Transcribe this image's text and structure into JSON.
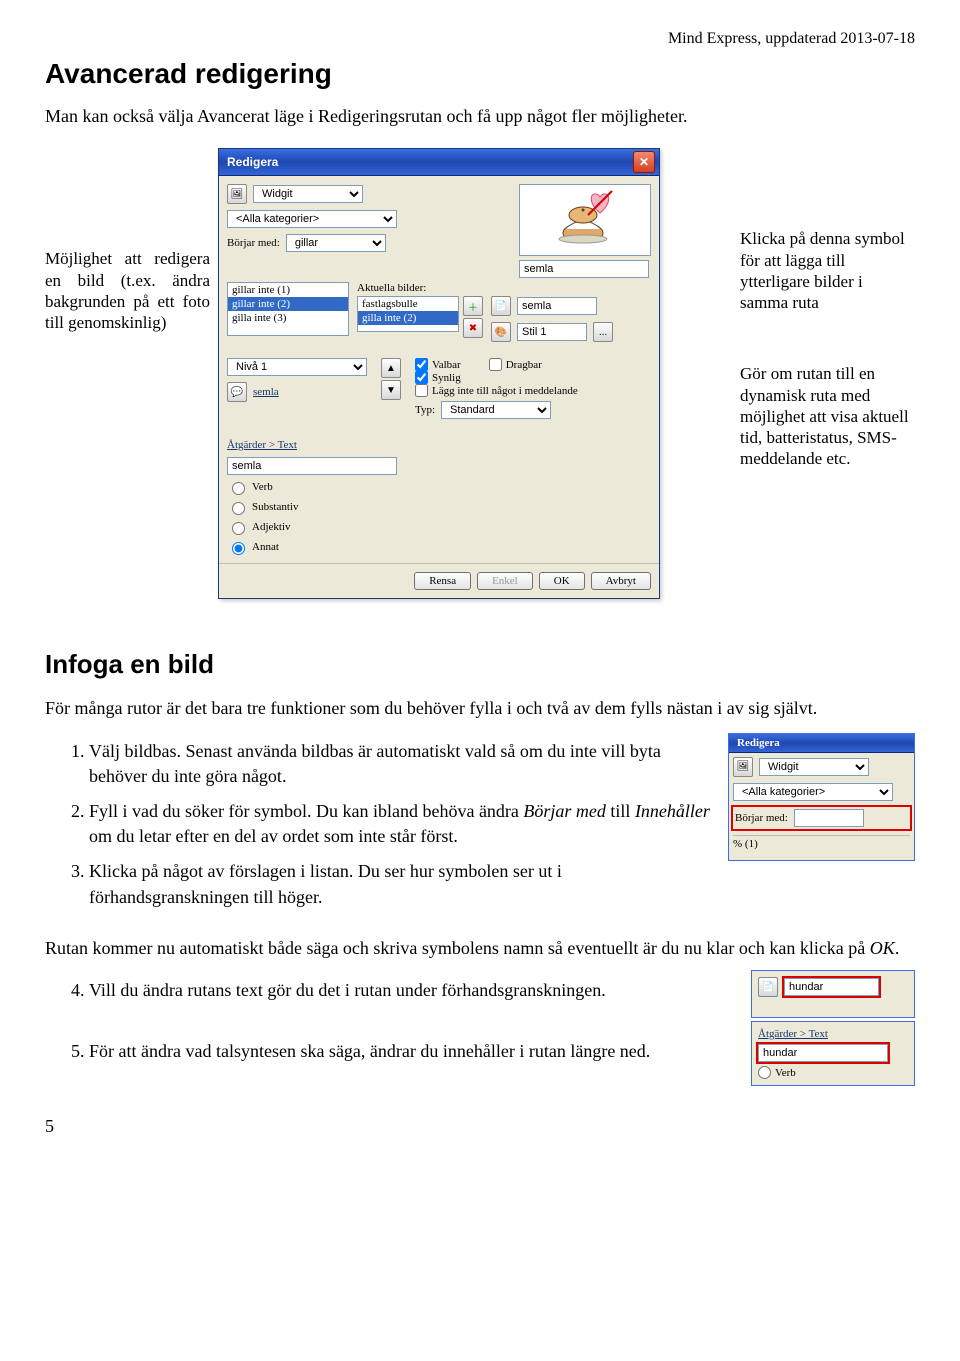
{
  "doc": {
    "header_right": "Mind Express, uppdaterad 2013-07-18",
    "page_number": "5",
    "h1": "Avancerad redigering",
    "intro": "Man kan också välja Avancerat läge i Redigeringsrutan och få upp något fler möjligheter.",
    "callout_left": "Möjlighet att redigera en bild (t.ex. ändra bakgrunden på ett foto till genomskinlig)",
    "callout_right_1": "Klicka på denna symbol för att lägga till ytterligare bilder i samma ruta",
    "callout_right_2": "Gör om rutan till en dynamisk ruta med möjlighet att visa aktuell tid, batteristatus, SMS-meddelande etc.",
    "h2": "Infoga en bild",
    "intro2": "För många rutor är det bara tre funktioner som du behöver fylla i och två av dem fylls nästan i av sig självt.",
    "steps": {
      "s1a": "Välj bildbas. Senast använda bildbas är automatiskt vald så om du inte vill byta behöver du inte göra något.",
      "s2a": "Fyll i vad du söker för symbol. Du kan ibland behöva ändra ",
      "s2_borjar": "Börjar med",
      "s2b": " till ",
      "s2_inne": "Innehåller",
      "s2c": " om du letar efter en del av ordet som inte står först.",
      "s3": "Klicka på något av förslagen i listan. Du ser hur symbolen ser ut i förhandsgranskningen till höger.",
      "mid": "Rutan kommer nu automatiskt både säga och skriva symbolens namn så eventuellt är du nu klar och kan klicka på ",
      "mid_ok": "OK",
      "mid_end": ".",
      "s4": "Vill du ändra rutans text gör du det i rutan under förhandsgranskningen.",
      "s5": "För att ändra vad talsyntesen ska säga, ändrar du innehåller i rutan längre ned."
    }
  },
  "dialog": {
    "title": "Redigera",
    "widgit": "Widgit",
    "all_cat": "<Alla kategorier>",
    "borjar_label": "Börjar med:",
    "borjar_value": "gillar",
    "phrase_list": [
      "gillar inte (1)",
      "gillar inte (2)",
      "gilla inte (3)"
    ],
    "phrase_sel_index": 1,
    "aktuella_label": "Aktuella bilder:",
    "aktuella_list": [
      "fastlagsbulle",
      "gilla inte (2)"
    ],
    "aktuella_sel_index": 1,
    "preview_text": "semla",
    "semla2": "semla",
    "stil_label": "Stil 1",
    "stil_more": "...",
    "niva_label": "Nivå 1",
    "chk_valbar": "Valbar",
    "chk_dragbar": "Dragbar",
    "chk_synlig": "Synlig",
    "chk_lagg": "Lägg inte till något i meddelande",
    "typ_label": "Typ:",
    "typ_value": "Standard",
    "semla_link": "semla",
    "atgarder": "Åtgärder > Text",
    "text_value": "semla",
    "radios": [
      "Verb",
      "Substantiv",
      "Adjektiv",
      "Annat"
    ],
    "radio_sel": 3,
    "btn_rensa": "Rensa",
    "btn_enkel": "Enkel",
    "btn_ok": "OK",
    "btn_avbryt": "Avbryt"
  },
  "mini1": {
    "title": "Redigera",
    "widgit": "Widgit",
    "all_cat": "<Alla kategorier>",
    "borjar_label": "Börjar med:",
    "borjar_value": "",
    "percent": "% (1)"
  },
  "mini2": {
    "value": "hundar"
  },
  "mini3": {
    "atgarder": "Åtgärder > Text",
    "value": "hundar",
    "verb": "Verb"
  }
}
